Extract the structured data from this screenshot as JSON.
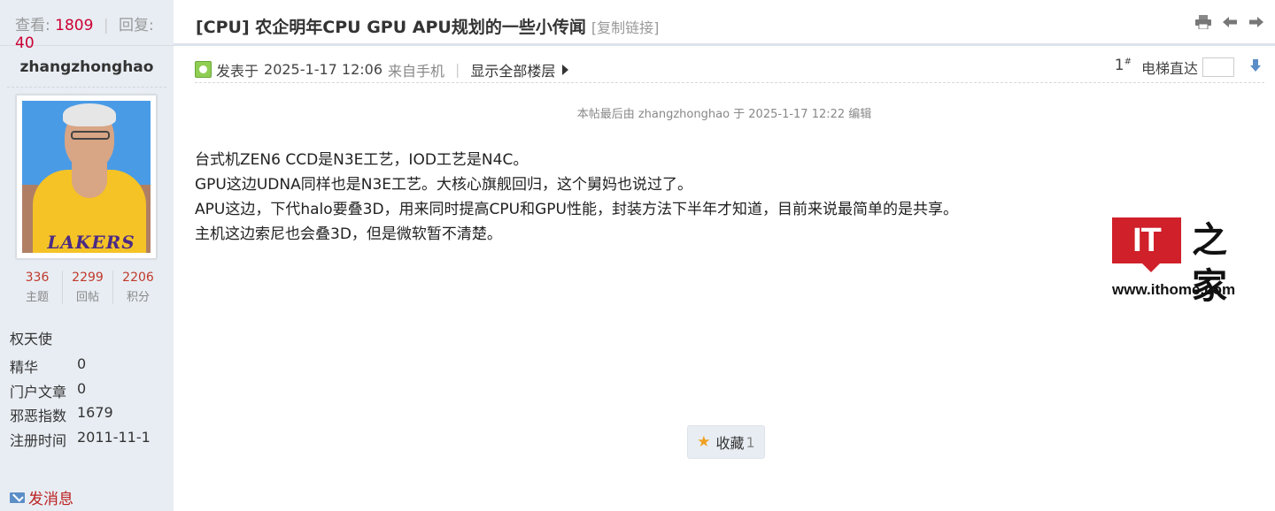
{
  "thread_stats": {
    "views_label": "查看:",
    "views": "1809",
    "sep": "|",
    "replies_label": "回复:",
    "replies": "40"
  },
  "author": {
    "username": "zhangzhonghao",
    "avatar_text": "LAKERS",
    "stats": [
      {
        "value": "336",
        "label": "主题"
      },
      {
        "value": "2299",
        "label": "回帖"
      },
      {
        "value": "2206",
        "label": "积分"
      }
    ],
    "rank": "权天使",
    "profile": [
      {
        "key": "精华",
        "value": "0"
      },
      {
        "key": "门户文章",
        "value": "0"
      },
      {
        "key": "邪恶指数",
        "value": "1679"
      },
      {
        "key": "注册时间",
        "value": "2011-11-1"
      }
    ],
    "send_message": "发消息"
  },
  "thread": {
    "title": "[CPU] 农企明年CPU GPU APU规划的一些小传闻",
    "copy_link": "[复制链接]",
    "icons": [
      "print-icon",
      "prev-arrow-icon",
      "next-arrow-icon"
    ]
  },
  "post": {
    "posted_prefix": "发表于",
    "posted_time": "2025-1-17 12:06",
    "posted_source": "来自手机",
    "meta_sep": "|",
    "show_all_floors": "显示全部楼层",
    "floor": "1",
    "floor_sup": "#",
    "jump_label": "电梯直达",
    "edit_note": "本帖最后由 zhangzhonghao 于 2025-1-17 12:22 编辑",
    "content_lines": [
      "台式机ZEN6 CCD是N3E工艺，IOD工艺是N4C。",
      "GPU这边UDNA同样也是N3E工艺。大核心旗舰回归，这个舅妈也说过了。",
      "APU这边，下代halo要叠3D，用来同时提高CPU和GPU性能，封装方法下半年才知道，目前来说最简单的是共享。",
      "主机这边索尼也会叠3D，但是微软暂不清楚。"
    ],
    "favorite_label": "收藏",
    "favorite_count": "1"
  },
  "watermark": {
    "logo_it": "IT",
    "logo_home": "之家",
    "url": "www.ithome.com"
  },
  "colors": {
    "sidebar_bg": "#e8edf3",
    "accent_red": "#c03",
    "logo_red": "#d0202a"
  }
}
